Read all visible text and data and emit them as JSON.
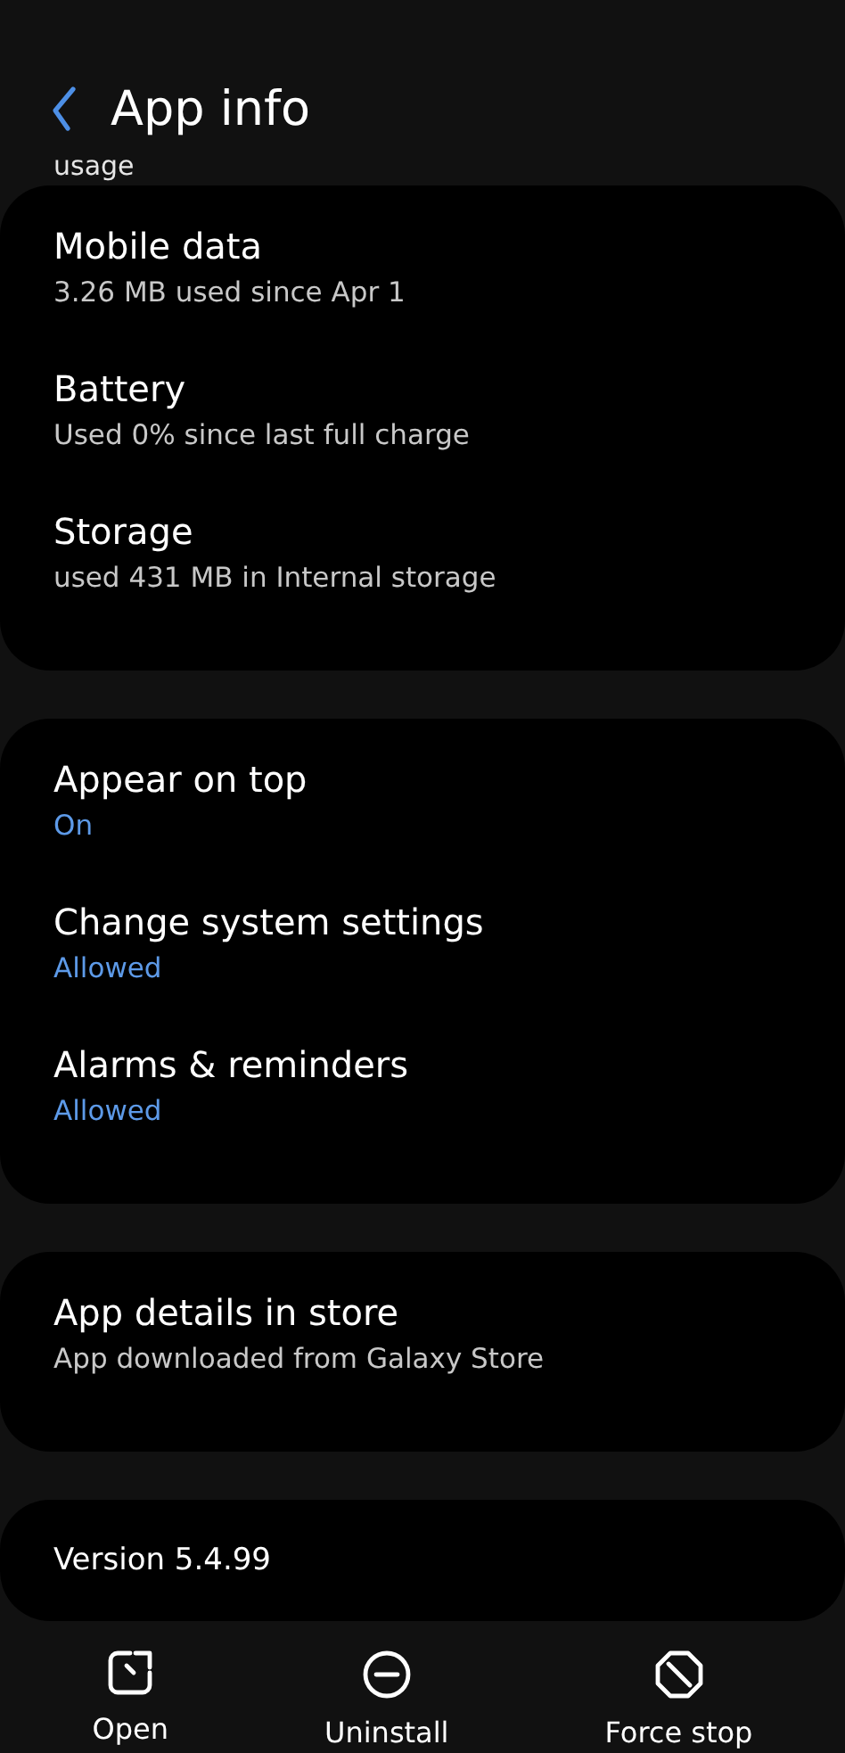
{
  "header": {
    "title": "App info"
  },
  "cut_label": "usage",
  "groups": [
    {
      "items": [
        {
          "title": "Mobile data",
          "summary": "3.26 MB used since Apr 1",
          "kind": "info"
        },
        {
          "title": "Battery",
          "summary": "Used 0% since last full charge",
          "kind": "info"
        },
        {
          "title": "Storage",
          "summary": "used 431 MB in Internal storage",
          "kind": "info"
        }
      ]
    },
    {
      "items": [
        {
          "title": "Appear on top",
          "summary": "On",
          "kind": "status"
        },
        {
          "title": "Change system settings",
          "summary": "Allowed",
          "kind": "status"
        },
        {
          "title": "Alarms & reminders",
          "summary": "Allowed",
          "kind": "status"
        }
      ]
    },
    {
      "items": [
        {
          "title": "App details in store",
          "summary": "App downloaded from Galaxy Store",
          "kind": "info"
        }
      ]
    },
    {
      "items": [
        {
          "title": "Version 5.4.99",
          "kind": "plain"
        }
      ]
    }
  ],
  "actions": [
    {
      "label": "Open",
      "kind": "open"
    },
    {
      "label": "Uninstall",
      "kind": "uninstall"
    },
    {
      "label": "Force stop",
      "kind": "stop"
    }
  ]
}
